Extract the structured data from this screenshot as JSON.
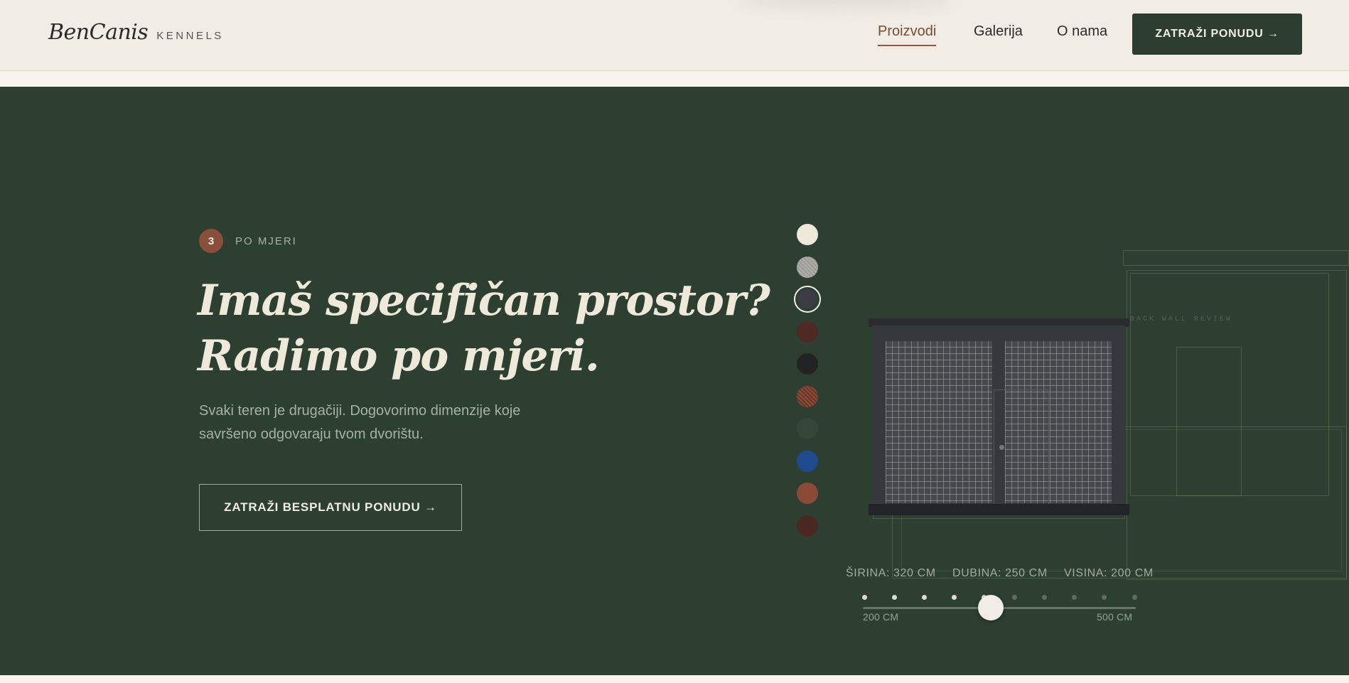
{
  "header": {
    "logo_name": "BenCanis",
    "logo_sub": "KENNELS",
    "nav": [
      {
        "label": "Proizvodi",
        "active": true
      },
      {
        "label": "Galerija",
        "active": false
      },
      {
        "label": "O nama",
        "active": false
      }
    ],
    "cta_label": "ZATRAŽI PONUDU →"
  },
  "hero": {
    "step_number": "3",
    "step_label": "PO MJERI",
    "heading_line1": "Imaš specifičan prostor?",
    "heading_line2": "Radimo po mjeri.",
    "description": "Svaki teren je drugačiji. Dogovorimo dimenzije koje savršeno odgovaraju tvom dvorištu.",
    "cta_label": "ZATRAŽI BESPLATNU PONUDU →"
  },
  "configurator": {
    "swatches": [
      {
        "name": "cream",
        "color": "#efe9dc"
      },
      {
        "name": "light-gray",
        "color": "#9a9c96"
      },
      {
        "name": "anthracite",
        "color": "#3c3d44",
        "selected": true
      },
      {
        "name": "dark-brown",
        "color": "#4d2a22"
      },
      {
        "name": "black",
        "color": "#222325"
      },
      {
        "name": "copper-pattern",
        "color": "#8b4a38"
      },
      {
        "name": "dark-green",
        "color": "#34453a"
      },
      {
        "name": "blue",
        "color": "#1e4a8e"
      },
      {
        "name": "rust",
        "color": "#8a4a36"
      },
      {
        "name": "chocolate",
        "color": "#4a2720"
      }
    ],
    "blueprint_label": "BACK WALL REVIEW",
    "dimensions": {
      "width": "ŠIRINA: 320 CM",
      "depth": "DUBINA: 250 CM",
      "height": "VISINA: 200 CM"
    },
    "slider": {
      "min_label": "200 CM",
      "max_label": "500 CM",
      "value_fraction": 0.47,
      "steps": 10,
      "active_steps": 5
    }
  },
  "colors": {
    "brand_green": "#2d3f30",
    "accent_brown": "#8a4f3a",
    "cream": "#f1ede4"
  }
}
